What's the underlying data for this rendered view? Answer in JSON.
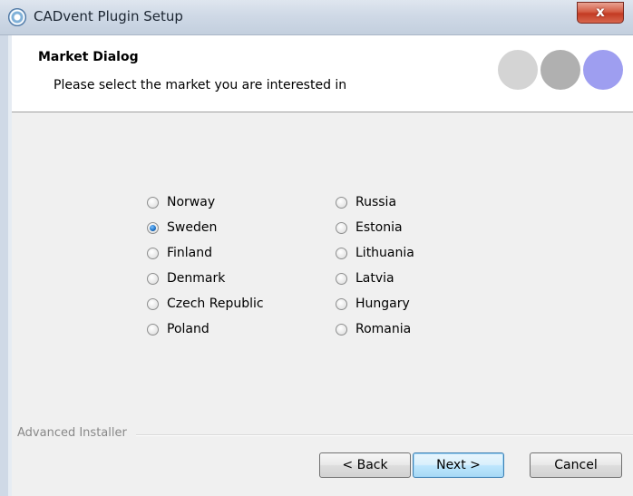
{
  "window": {
    "title": "CADvent Plugin Setup",
    "close_label": "x"
  },
  "header": {
    "title": "Market Dialog",
    "subtitle": "Please select the market you are interested in"
  },
  "markets": {
    "selected": "Sweden",
    "left": [
      "Norway",
      "Sweden",
      "Finland",
      "Denmark",
      "Czech Republic",
      "Poland"
    ],
    "right": [
      "Russia",
      "Estonia",
      "Lithuania",
      "Latvia",
      "Hungary",
      "Romania"
    ]
  },
  "footer": {
    "brand": "Advanced Installer",
    "back_label": "< Back",
    "next_label": "Next >",
    "cancel_label": "Cancel"
  },
  "colors": {
    "header_circles": [
      "#d4d4d4",
      "#b0b0b0",
      "#9e9ef0"
    ],
    "close_button": "#c33a23",
    "selected_radio": "#1a6fc4"
  }
}
